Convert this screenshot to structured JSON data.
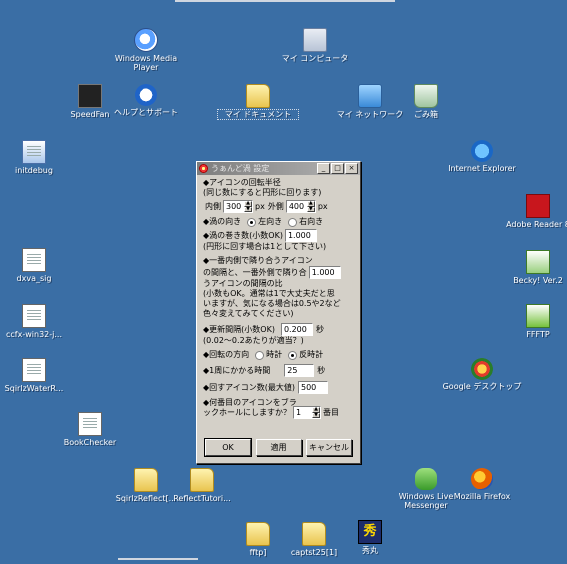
{
  "desktop": {
    "icons": {
      "wmp": "Windows Media Player",
      "my_computer": "マイ コンピュータ",
      "speedfan": "SpeedFan",
      "help": "ヘルプとサポート",
      "my_documents": "マイ ドキュメント",
      "my_network": "マイ ネットワーク",
      "recycle_bin": "ごみ箱",
      "initdebug": "initdebug",
      "ie": "Internet Explorer",
      "dxva": "dxva_sig",
      "ccfx": "ccfx-win32-j...",
      "adobe": "Adobe Reader 8",
      "becky": "Becky! Ver.2",
      "ffftp": "FFFTP",
      "sqirlz_water": "SqirlzWaterR...",
      "google": "Google デスクトップ",
      "bookchecker": "BookChecker",
      "sqirlz_reflect": "SqirlzReflect[...",
      "reflect_tutorial": "ReflectTutori...",
      "messenger": "Windows Live Messenger",
      "firefox": "Mozilla Firefox",
      "fftp": "fftp]",
      "captst": "captst25[1]",
      "hidemaru": "秀丸"
    }
  },
  "dialog": {
    "title": "うぁんど渦 設定",
    "title_buttons": [
      "_",
      "□",
      "×"
    ],
    "radius_header": "◆アイコンの回転半径",
    "radius_note": "(同じ数にすると円形に回ります)",
    "inner_label": "内側",
    "inner_value": "300",
    "inner_unit": "px",
    "outer_label": "外側",
    "outer_value": "400",
    "outer_unit": "px",
    "direction_label": "◆渦の向き",
    "direction_left": "左向き",
    "direction_right": "右向き",
    "turns_label": "◆渦の巻き数(小数OK)",
    "turns_value": "1.000",
    "turns_note": "(円形に回す場合は1として下さい)",
    "ratio_line1": "◆一番内側で隣り合うアイコン",
    "ratio_line2": "の間隔と、一番外側で隣り合",
    "ratio_line3": "うアイコンの間隔の比",
    "ratio_value": "1.000",
    "ratio_note1": "(小数もOK。通常は1で大丈夫だと思",
    "ratio_note2": "いますが、気になる場合は0.5や2など",
    "ratio_note3": "色々変えてみてください)",
    "interval_label": "◆更新間隔(小数OK)",
    "interval_value": "0.200",
    "interval_unit": "秒",
    "interval_note": "(0.02～0.2あたりが適当？)",
    "rotation_label": "◆回転の方向",
    "rotation_cw": "時計",
    "rotation_ccw": "反時計",
    "period_label": "◆1周にかかる時間",
    "period_value": "25",
    "period_unit": "秒",
    "max_icons_label": "◆回すアイコン数(最大値)",
    "max_icons_value": "500",
    "blackhole_line1": "◆何番目のアイコンをブラ",
    "blackhole_line2": "ックホールにしますか？",
    "blackhole_value": "1",
    "blackhole_unit": "番目",
    "ok": "OK",
    "apply": "適用",
    "cancel": "キャンセル"
  }
}
